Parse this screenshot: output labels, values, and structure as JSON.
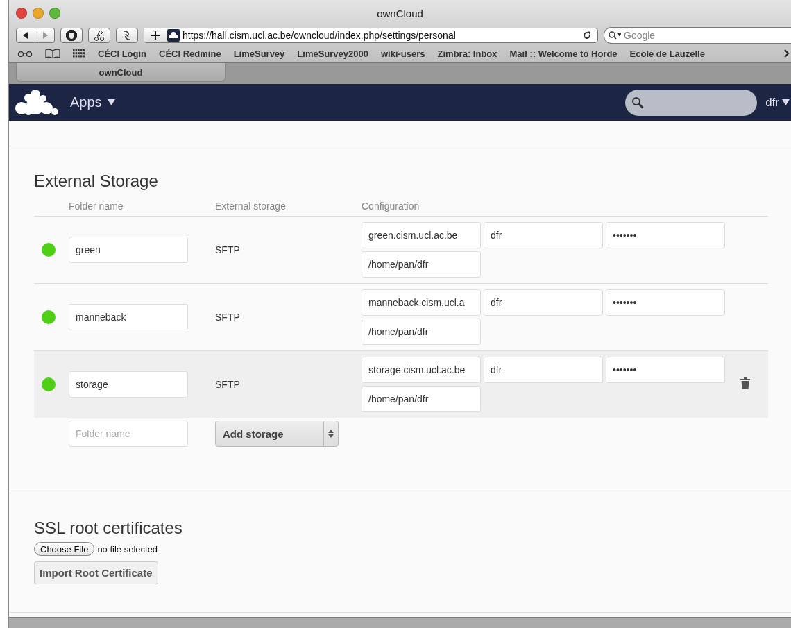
{
  "window": {
    "title": "ownCloud"
  },
  "toolbar": {
    "url": "https://hall.cism.ucl.ac.be/owncloud/index.php/settings/personal",
    "search_placeholder": "Google"
  },
  "bookmarks": [
    "CÉCI Login",
    "CÉCI Redmine",
    "LimeSurvey",
    "LimeSurvey2000",
    "wiki-users",
    "Zimbra: Inbox",
    "Mail :: Welcome to Horde",
    "Ecole de Lauzelle"
  ],
  "tabs": [
    {
      "label": "ownCloud",
      "selected": true
    }
  ],
  "header": {
    "apps_menu": "Apps",
    "user_menu": "dfr"
  },
  "external_storage": {
    "title": "External Storage",
    "columns": [
      "Folder name",
      "External storage",
      "Configuration"
    ],
    "mounts": [
      {
        "folder": "green",
        "backend": "SFTP",
        "host": "green.cism.ucl.ac.be",
        "user": "dfr",
        "password": "•••••••",
        "root": "/home/pan/dfr",
        "color": "#4fcf15",
        "highlighted": false
      },
      {
        "folder": "manneback",
        "backend": "SFTP",
        "host": "manneback.cism.ucl.a",
        "user": "dfr",
        "password": "•••••••",
        "root": "/home/pan/dfr",
        "color": "#4fcf15",
        "highlighted": false
      },
      {
        "folder": "storage",
        "backend": "SFTP",
        "host": "storage.cism.ucl.ac.be",
        "user": "dfr",
        "password": "•••••••",
        "root": "/home/pan/dfr",
        "color": "#4fcf15",
        "highlighted": true
      }
    ],
    "new_mount": {
      "placeholder": "Folder name",
      "select": "Add storage"
    }
  },
  "ssl": {
    "title": "SSL root certificates",
    "choose_file": "Choose File",
    "file_status": "no file selected",
    "import_button": "Import Root Certificate"
  }
}
